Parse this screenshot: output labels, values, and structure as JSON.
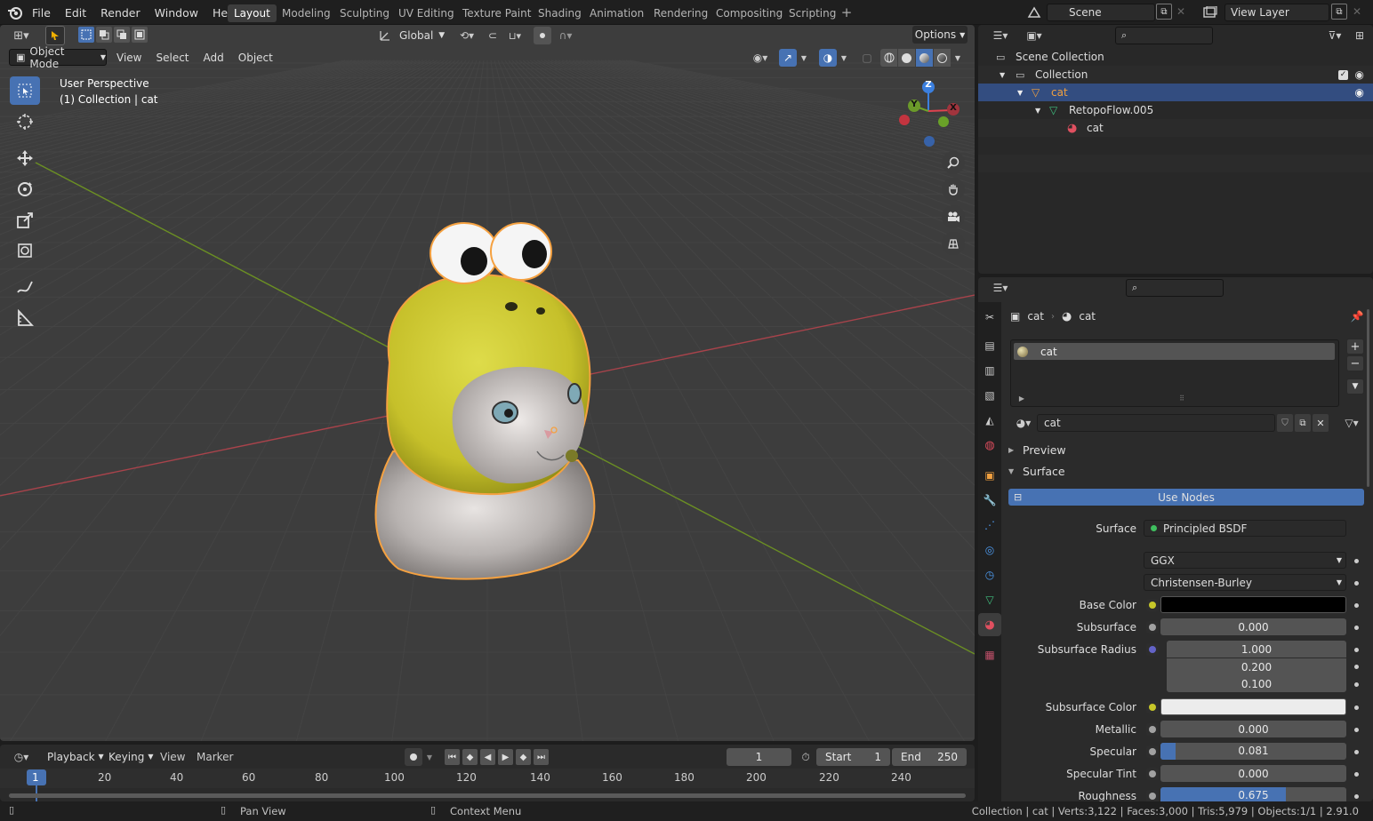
{
  "app": {
    "menus": [
      "File",
      "Edit",
      "Render",
      "Window",
      "Help"
    ]
  },
  "workspaces": [
    "Layout",
    "Modeling",
    "Sculpting",
    "UV Editing",
    "Texture Paint",
    "Shading",
    "Animation",
    "Rendering",
    "Compositing",
    "Scripting"
  ],
  "scene": {
    "label": "Scene",
    "view_layer": "View Layer"
  },
  "viewport": {
    "mode": "Object Mode",
    "menus": [
      "View",
      "Select",
      "Add",
      "Object"
    ],
    "orientation": "Global",
    "options": "Options",
    "perspective": "User Perspective",
    "collection": "(1) Collection | cat",
    "gizmo": {
      "z": "Z",
      "y": "Y",
      "x": "X"
    },
    "colors": {
      "grid": "#444444",
      "x_axis": "#a8434b",
      "y_axis": "#6b8f23",
      "selection": "#f5a140",
      "hat": "#c7c22c"
    }
  },
  "outliner": {
    "items": [
      {
        "label": "Scene Collection",
        "icon": "scene-collection-icon"
      },
      {
        "label": "Collection",
        "icon": "collection-icon"
      },
      {
        "label": "cat",
        "icon": "mesh-object-icon"
      },
      {
        "label": "RetopoFlow.005",
        "icon": "mesh-data-icon"
      },
      {
        "label": "cat",
        "icon": "material-icon"
      }
    ]
  },
  "properties": {
    "breadcrumb": [
      "cat",
      "cat"
    ],
    "slot": "cat",
    "material_name": "cat",
    "preview_label": "Preview",
    "surface_label": "Surface",
    "use_nodes": "Use Nodes",
    "surface_shader": "Principled BSDF",
    "distribution": "GGX",
    "subsurface_method": "Christensen-Burley",
    "fields": [
      {
        "label": "Surface",
        "value": "Principled BSDF"
      },
      {
        "label": "Base Color",
        "value": "",
        "color": "#000000"
      },
      {
        "label": "Subsurface",
        "value": "0.000"
      },
      {
        "label": "Subsurface Radius",
        "value": "1.000"
      },
      {
        "label": "",
        "value": "0.200"
      },
      {
        "label": "",
        "value": "0.100"
      },
      {
        "label": "Subsurface Color",
        "value": "",
        "color": "#ececec"
      },
      {
        "label": "Metallic",
        "value": "0.000"
      },
      {
        "label": "Specular",
        "value": "0.081",
        "fill": 0.081
      },
      {
        "label": "Specular Tint",
        "value": "0.000"
      },
      {
        "label": "Roughness",
        "value": "0.675",
        "fill": 0.675
      }
    ]
  },
  "timeline": {
    "menus": [
      "Playback",
      "Keying",
      "View",
      "Marker"
    ],
    "current_frame": "1",
    "start_label": "Start",
    "start": "1",
    "end_label": "End",
    "end": "250",
    "ticks": [
      "1",
      "20",
      "40",
      "60",
      "80",
      "100",
      "120",
      "140",
      "160",
      "180",
      "200",
      "220",
      "240"
    ]
  },
  "status": {
    "pan": "Pan View",
    "context": "Context Menu",
    "stats": "Collection | cat | Verts:3,122 | Faces:3,000 | Tris:5,979 | Objects:1/1 | 2.91.0"
  }
}
